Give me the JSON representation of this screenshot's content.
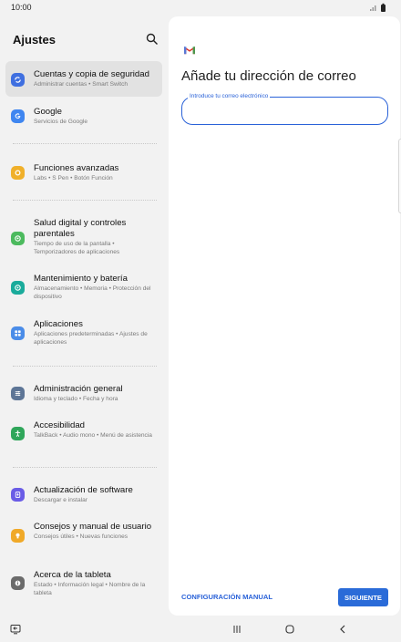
{
  "status": {
    "time": "10:00"
  },
  "settings": {
    "title": "Ajustes",
    "items": [
      {
        "title": "Cuentas y copia de seguridad",
        "subtitle": "Administrar cuentas • Smart Switch",
        "icon": "sync-icon",
        "color": "#3f6fe0"
      },
      {
        "title": "Google",
        "subtitle": "Servicios de Google",
        "icon": "google-icon",
        "color": "#3f86f0"
      },
      {
        "title": "Funciones avanzadas",
        "subtitle": "Labs • S Pen • Botón Función",
        "icon": "star-icon",
        "color": "#f0b02a"
      },
      {
        "title": "Salud digital y controles parentales",
        "subtitle": "Tiempo de uso de la pantalla • Temporizadores de aplicaciones",
        "icon": "heart-icon",
        "color": "#4cba5e"
      },
      {
        "title": "Mantenimiento y batería",
        "subtitle": "Almacenamiento • Memoria • Protección del dispositivo",
        "icon": "battery-icon",
        "color": "#1aab9b"
      },
      {
        "title": "Aplicaciones",
        "subtitle": "Aplicaciones predeterminadas • Ajustes de aplicaciones",
        "icon": "apps-icon",
        "color": "#4a8ce8"
      },
      {
        "title": "Administración general",
        "subtitle": "Idioma y teclado • Fecha y hora",
        "icon": "sliders-icon",
        "color": "#5d7596"
      },
      {
        "title": "Accesibilidad",
        "subtitle": "TalkBack • Audio mono • Menú de asistencia",
        "icon": "accessibility-icon",
        "color": "#2fa65a"
      },
      {
        "title": "Actualización de software",
        "subtitle": "Descargar e instalar",
        "icon": "update-icon",
        "color": "#6a5ce6"
      },
      {
        "title": "Consejos y manual de usuario",
        "subtitle": "Consejos útiles • Nuevas funciones",
        "icon": "bulb-icon",
        "color": "#f0a928"
      },
      {
        "title": "Acerca de la tableta",
        "subtitle": "Estado • Información legal • Nombre de la tableta",
        "icon": "info-icon",
        "color": "#6b6b6b"
      }
    ]
  },
  "gmail": {
    "heading": "Añade tu dirección de correo",
    "email_label": "Introduce tu correo electrónico",
    "email_value": "",
    "manual_label": "CONFIGURACIÓN MANUAL",
    "next_label": "SIGUIENTE"
  }
}
